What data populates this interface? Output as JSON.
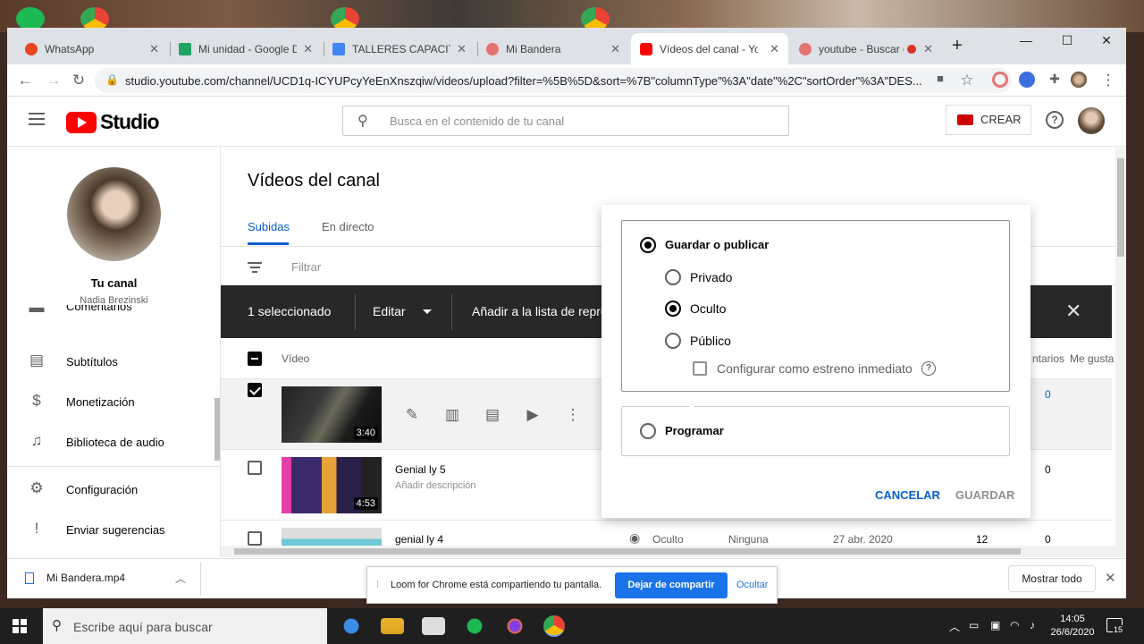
{
  "browser": {
    "tabs": [
      {
        "label": "WhatsApp",
        "color": "#e8471e"
      },
      {
        "label": "Mi unidad - Google Dr",
        "color": "#1fa463"
      },
      {
        "label": "TALLERES CAPACITACIÓ",
        "color": "#4285f4"
      },
      {
        "label": "Mi Bandera",
        "color": "#e57373"
      },
      {
        "label": "Vídeos del canal - YouT",
        "color": "#ff0000"
      },
      {
        "label": "youtube - Buscar c",
        "color": "#e57373"
      }
    ],
    "active_tab": 4,
    "url": "studio.youtube.com/channel/UCD1q-ICYUPcyYeEnXnszqiw/videos/upload?filter=%5B%5D&sort=%7B\"columnType\"%3A\"date\"%2C\"sortOrder\"%3A\"DES..."
  },
  "header": {
    "logo_text": "Studio",
    "search_placeholder": "Busca en el contenido de tu canal",
    "create_label": "CREAR",
    "help_glyph": "?"
  },
  "sidebar": {
    "channel_label": "Tu canal",
    "channel_user": "Nadia Brezinski",
    "items": [
      {
        "label": "Comentarios",
        "icon": "comment-icon"
      },
      {
        "label": "Subtítulos",
        "icon": "subtitles-icon"
      },
      {
        "label": "Monetización",
        "icon": "dollar-icon"
      },
      {
        "label": "Biblioteca de audio",
        "icon": "audio-library-icon"
      },
      {
        "label": "Configuración",
        "icon": "gear-icon"
      },
      {
        "label": "Enviar sugerencias",
        "icon": "feedback-icon"
      }
    ]
  },
  "main": {
    "title": "Vídeos del canal",
    "tabs": [
      "Subidas",
      "En directo"
    ],
    "filter_placeholder": "Filtrar",
    "bulk": {
      "selected": "1 seleccionado",
      "edit": "Editar",
      "add_to_list": "Añadir a la lista de reproducción"
    },
    "columns": {
      "video": "Vídeo",
      "comments": "ntarios",
      "likes": "Me gusta"
    },
    "rows": [
      {
        "title": "",
        "description": "",
        "duration": "3:40",
        "selected": true,
        "comments": "0"
      },
      {
        "title": "Genial ly 5",
        "description": "Añadir descripción",
        "duration": "4:53",
        "selected": false,
        "comments": "0"
      },
      {
        "title": "genial ly 4",
        "description": "",
        "duration": "",
        "selected": false,
        "visibility": "Oculto",
        "restrictions": "Ninguna",
        "date": "27 abr. 2020",
        "views": "12",
        "comments": "0"
      }
    ]
  },
  "visibility_popup": {
    "save_or_publish": "Guardar o publicar",
    "private": "Privado",
    "unlisted": "Oculto",
    "public": "Público",
    "premiere": "Configurar como estreno inmediato",
    "schedule": "Programar",
    "cancel": "CANCELAR",
    "save": "GUARDAR",
    "selected": "Oculto"
  },
  "downloads": {
    "file": "Mi Bandera.mp4",
    "show_all": "Mostrar todo"
  },
  "loom": {
    "message": "Loom for Chrome está compartiendo tu pantalla.",
    "stop": "Dejar de compartir",
    "hide": "Ocultar"
  },
  "taskbar": {
    "search_placeholder": "Escribe aquí para buscar",
    "time": "14:05",
    "date": "26/6/2020",
    "notifications": "15"
  }
}
